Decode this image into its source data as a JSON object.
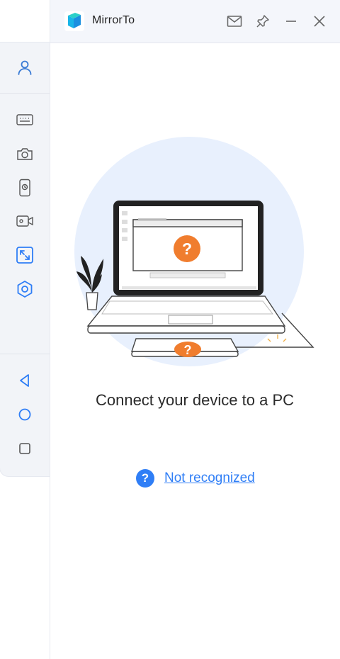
{
  "window": {
    "title": "MirrorTo"
  },
  "titlebar": {
    "buttons": [
      "mail-icon",
      "pin-icon",
      "minimize-icon",
      "close-icon"
    ]
  },
  "sidebar": {
    "top_items": [
      "user-icon"
    ],
    "tool_items": [
      "keyboard-icon",
      "camera-icon",
      "phone-record-icon",
      "video-icon",
      "fullscreen-icon",
      "settings-icon"
    ],
    "nav_items": [
      "back-icon",
      "home-icon",
      "recents-icon"
    ]
  },
  "main": {
    "illustration_badges": [
      "?",
      "?"
    ],
    "connect_message": "Connect your device to a PC",
    "not_recognized_badge": "?",
    "not_recognized_link": "Not recognized"
  },
  "colors": {
    "accent": "#2f7ef6",
    "sidebar_icon": "#3a7bd5",
    "warning_orange": "#f07d2e",
    "circle_bg": "#e8f0fd"
  }
}
